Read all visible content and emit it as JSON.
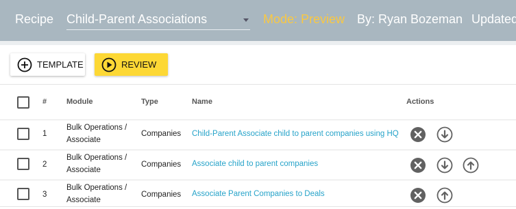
{
  "topbar": {
    "recipe_label": "Recipe",
    "recipe_select_value": "Child-Parent Associations",
    "mode_label": "Mode: Preview",
    "by_label": "By: Ryan Bozeman",
    "updated_label": "Updated"
  },
  "toolbar": {
    "template_label": "TEMPLATE",
    "review_label": "REVIEW"
  },
  "table": {
    "headers": {
      "num": "#",
      "module": "Module",
      "type": "Type",
      "name": "Name",
      "actions": "Actions"
    },
    "rows": [
      {
        "num": "1",
        "module_line1": "Bulk Operations /",
        "module_line2": "Associate",
        "type": "Companies",
        "name": "Child-Parent Associate child to parent companies using HQ"
      },
      {
        "num": "2",
        "module_line1": "Bulk Operations /",
        "module_line2": "Associate",
        "type": "Companies",
        "name": "Associate child to parent companies"
      },
      {
        "num": "3",
        "module_line1": "Bulk Operations /",
        "module_line2": "Associate",
        "type": "Companies",
        "name": "Associate Parent Companies to Deals"
      }
    ]
  },
  "colors": {
    "topbar": "#a9b7c0",
    "mode": "#f9c843",
    "link": "#26a3c9",
    "review_button": "#fdd835",
    "action_icon": "#616161"
  },
  "icons": {
    "template_button": "plus-circle-icon",
    "review_button": "play-circle-icon",
    "row_actions": [
      "remove-icon",
      "move-down-icon",
      "move-up-icon"
    ]
  }
}
